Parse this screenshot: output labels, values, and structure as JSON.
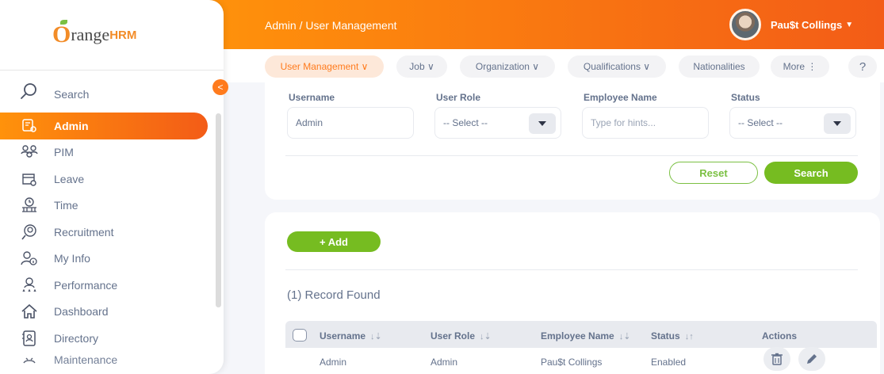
{
  "brand": {
    "logo_o": "O",
    "logo_text": "range",
    "logo_hrm": "HRM"
  },
  "header": {
    "breadcrumb": "Admin / User Management",
    "user_name": "Pau$t Collings",
    "user_caret": "▼"
  },
  "sidebar": {
    "search_label": "Search",
    "collapse_glyph": "<",
    "items": [
      {
        "label": "Admin",
        "icon": "admin-icon",
        "active": true
      },
      {
        "label": "PIM",
        "icon": "pim-icon"
      },
      {
        "label": "Leave",
        "icon": "leave-icon"
      },
      {
        "label": "Time",
        "icon": "time-icon"
      },
      {
        "label": "Recruitment",
        "icon": "recruitment-icon"
      },
      {
        "label": "My Info",
        "icon": "my-info-icon"
      },
      {
        "label": "Performance",
        "icon": "performance-icon"
      },
      {
        "label": "Dashboard",
        "icon": "dashboard-icon"
      },
      {
        "label": "Directory",
        "icon": "directory-icon"
      },
      {
        "label": "Maintenance",
        "icon": "maintenance-icon"
      }
    ]
  },
  "tabs": {
    "user_management": "User Management ∨",
    "job": "Job ∨",
    "organization": "Organization ∨",
    "qualifications": "Qualifications ∨",
    "nationalities": "Nationalities",
    "more": "More ⋮",
    "help": "?"
  },
  "filter": {
    "username_label": "Username",
    "username_value": "Admin",
    "user_role_label": "User Role",
    "user_role_value": "-- Select --",
    "employee_name_label": "Employee Name",
    "employee_name_placeholder": "Type for hints...",
    "status_label": "Status",
    "status_value": "-- Select --",
    "reset_label": "Reset",
    "search_label": "Search"
  },
  "results": {
    "add_label": "+ Add",
    "records_text": "(1) Record Found",
    "columns": {
      "username": "Username",
      "user_role": "User Role",
      "employee_name": "Employee Name",
      "status": "Status",
      "actions": "Actions"
    },
    "sort_glyph": "↓⇣",
    "sort_glyph_status": "↓↑",
    "rows": [
      {
        "username": "Admin",
        "user_role": "Admin",
        "employee_name": "Pau$t Collings",
        "status": "Enabled"
      }
    ]
  },
  "colors": {
    "accent": "#ff7b1d",
    "green": "#76bc21",
    "text": "#64728c"
  }
}
